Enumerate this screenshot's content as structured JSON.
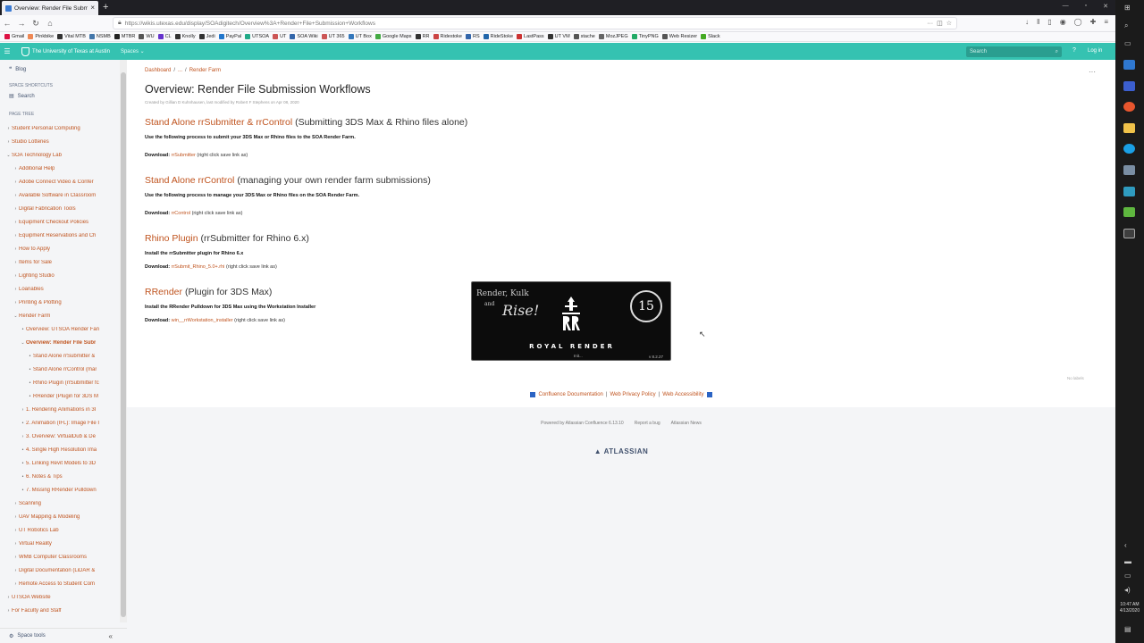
{
  "browser": {
    "tab_title": "Overview: Render File Submission",
    "url": "https://wikis.utexas.edu/display/SOAdigitech/Overview%3A+Render+File+Submission+Workflows",
    "bookmarks": [
      "Gmail",
      "Pinkbike",
      "Vital MTB",
      "NSMB",
      "MTBR",
      "WU",
      "CL",
      "Knolly",
      "Jedi",
      "PayPal",
      "UTSOA",
      "UT",
      "SOA Wiki",
      "UT 365",
      "UT Box",
      "Google Maps",
      "RR",
      "Ridestoke",
      "RS",
      "RideStoke",
      "LastPass",
      "UT VM",
      "stache",
      "MozJPEG",
      "TinyPNG",
      "Web Resizer",
      "Slack"
    ]
  },
  "confluence": {
    "site_title": "The University of Texas at Austin",
    "spaces_label": "Spaces",
    "search_placeholder": "Search",
    "login_label": "Log in"
  },
  "sidebar": {
    "blog": "Blog",
    "shortcuts_label": "SPACE SHORTCUTS",
    "search": "Search",
    "page_tree_label": "PAGE TREE",
    "items": [
      {
        "label": "Student Personal Computing",
        "level": 0,
        "arrow": "›"
      },
      {
        "label": "Studio Lotteries",
        "level": 0,
        "arrow": "›"
      },
      {
        "label": "SOA Technology Lab",
        "level": 0,
        "arrow": "⌄"
      },
      {
        "label": "Additional Help",
        "level": 1,
        "arrow": "›"
      },
      {
        "label": "Adobe Connect Video & Confer",
        "level": 1,
        "arrow": "›"
      },
      {
        "label": "Available Software in Classroom",
        "level": 1,
        "arrow": "›"
      },
      {
        "label": "Digital Fabrication Tools",
        "level": 1,
        "arrow": "›"
      },
      {
        "label": "Equipment Checkout Policies",
        "level": 1,
        "arrow": "›"
      },
      {
        "label": "Equipment Reservations and Ch",
        "level": 1,
        "arrow": "›"
      },
      {
        "label": "How to Apply",
        "level": 1,
        "arrow": "›"
      },
      {
        "label": "Items for Sale",
        "level": 1,
        "arrow": "›"
      },
      {
        "label": "Lighting Studio",
        "level": 1,
        "arrow": "›"
      },
      {
        "label": "Loanables",
        "level": 1,
        "arrow": "›"
      },
      {
        "label": "Printing & Plotting",
        "level": 1,
        "arrow": "›"
      },
      {
        "label": "Render Farm",
        "level": 1,
        "arrow": "⌄"
      },
      {
        "label": "Overview: UTSOA Render Fan",
        "level": 2,
        "arrow": "•"
      },
      {
        "label": "Overview: Render File Subr",
        "level": 2,
        "arrow": "⌄",
        "active": true
      },
      {
        "label": "Stand Alone rrSubmitter &",
        "level": 3,
        "arrow": "•"
      },
      {
        "label": "Stand Alone rrControl (mar",
        "level": 3,
        "arrow": "•"
      },
      {
        "label": "Rhino Plugin (rrSubmitter fc",
        "level": 3,
        "arrow": "•"
      },
      {
        "label": "RRender (Plugin for 3DS M",
        "level": 3,
        "arrow": "•"
      },
      {
        "label": "1. Rendering Animations in 3I",
        "level": 2,
        "arrow": "›"
      },
      {
        "label": "2. Animation (IFL): Image File I",
        "level": 2,
        "arrow": "•"
      },
      {
        "label": "3. Overview: VirtualDub & De",
        "level": 2,
        "arrow": "›"
      },
      {
        "label": "4. Single High Resolution Ima",
        "level": 2,
        "arrow": "•"
      },
      {
        "label": "5. Linking Revit Models to 3D",
        "level": 2,
        "arrow": "•"
      },
      {
        "label": "6. Notes & Tips",
        "level": 2,
        "arrow": "•"
      },
      {
        "label": "7. Missing RRender Pulldown",
        "level": 2,
        "arrow": "•"
      },
      {
        "label": "Scanning",
        "level": 1,
        "arrow": "›"
      },
      {
        "label": "UAV Mapping & Modeling",
        "level": 1,
        "arrow": "›"
      },
      {
        "label": "UT Robotics Lab",
        "level": 1,
        "arrow": "›"
      },
      {
        "label": "Virtual Reality",
        "level": 1,
        "arrow": "›"
      },
      {
        "label": "WMB Computer Classrooms",
        "level": 1,
        "arrow": "›"
      },
      {
        "label": "Digital Documentation (LiDAR &",
        "level": 1,
        "arrow": "›"
      },
      {
        "label": "Remote Access to Student Com",
        "level": 1,
        "arrow": "›"
      },
      {
        "label": "UTSOA Website",
        "level": 0,
        "arrow": "›"
      },
      {
        "label": "For Faculty and Staff",
        "level": 0,
        "arrow": "›"
      }
    ],
    "space_tools": "Space tools"
  },
  "page": {
    "breadcrumb": [
      "Dashboard",
      "...",
      "Render Farm"
    ],
    "title": "Overview: Render File Submission Workflows",
    "meta": "Created by Gillian D Kuhnhausen, last modified by Robert F Stephens on Apr 08, 2020",
    "sections": [
      {
        "link": "Stand Alone rrSubmitter & rrControl",
        "rest": " (Submitting 3DS Max & Rhino files alone)",
        "instruction": "Use the following process to submit your 3DS Max or Rhino files to the SOA Render Farm.",
        "download_label": "Download:",
        "download_link": "rrSubmitter",
        "download_note": " (right click save link as)"
      },
      {
        "link": "Stand Alone rrControl",
        "rest": " (managing your own render farm submissions)",
        "instruction": "Use the following process to manage your 3DS Max or Rhino files on the SOA Render Farm.",
        "download_label": "Download:",
        "download_link": "rrControl",
        "download_note": " (right click save link as)"
      },
      {
        "link": "Rhino Plugin",
        "rest": " (rrSubmitter for Rhino 6.x)",
        "instruction": "Install the rrSubmitter plugin for Rhino 6.x",
        "download_label": "Download:",
        "download_link": "rrSubmit_Rhino_5.0+.rhi",
        "download_note": " (right click save link as)"
      },
      {
        "link": "RRender",
        "rest": " (Plugin for 3DS Max)",
        "instruction": "Install the RRender Pulldown for 3DS Max using the Workstation Installer",
        "download_label": "Download:",
        "download_link": "win__rrWorkstation_installer",
        "download_note": " (right click save link as)"
      }
    ],
    "splash": {
      "slogan_top": "Render, Kulk",
      "slogan_and": "and",
      "slogan_big": "Rise!",
      "badge": "15",
      "brand": "ROYAL RENDER",
      "init": "Init...",
      "version": "v 8.2.27"
    },
    "no_labels": "No labels"
  },
  "footer": {
    "links": [
      "Confluence Documentation",
      "Web Privacy Policy",
      "Web Accessibility"
    ],
    "powered": "Powered by Atlassian Confluence 6.13.10",
    "report": "Report a bug",
    "news": "Atlassian News",
    "atlassian": "ATLASSIAN"
  },
  "taskbar": {
    "time": "10:47 AM",
    "date": "4/13/2020"
  },
  "colors": {
    "accent": "#35c2b1",
    "link": "#c0541f"
  }
}
